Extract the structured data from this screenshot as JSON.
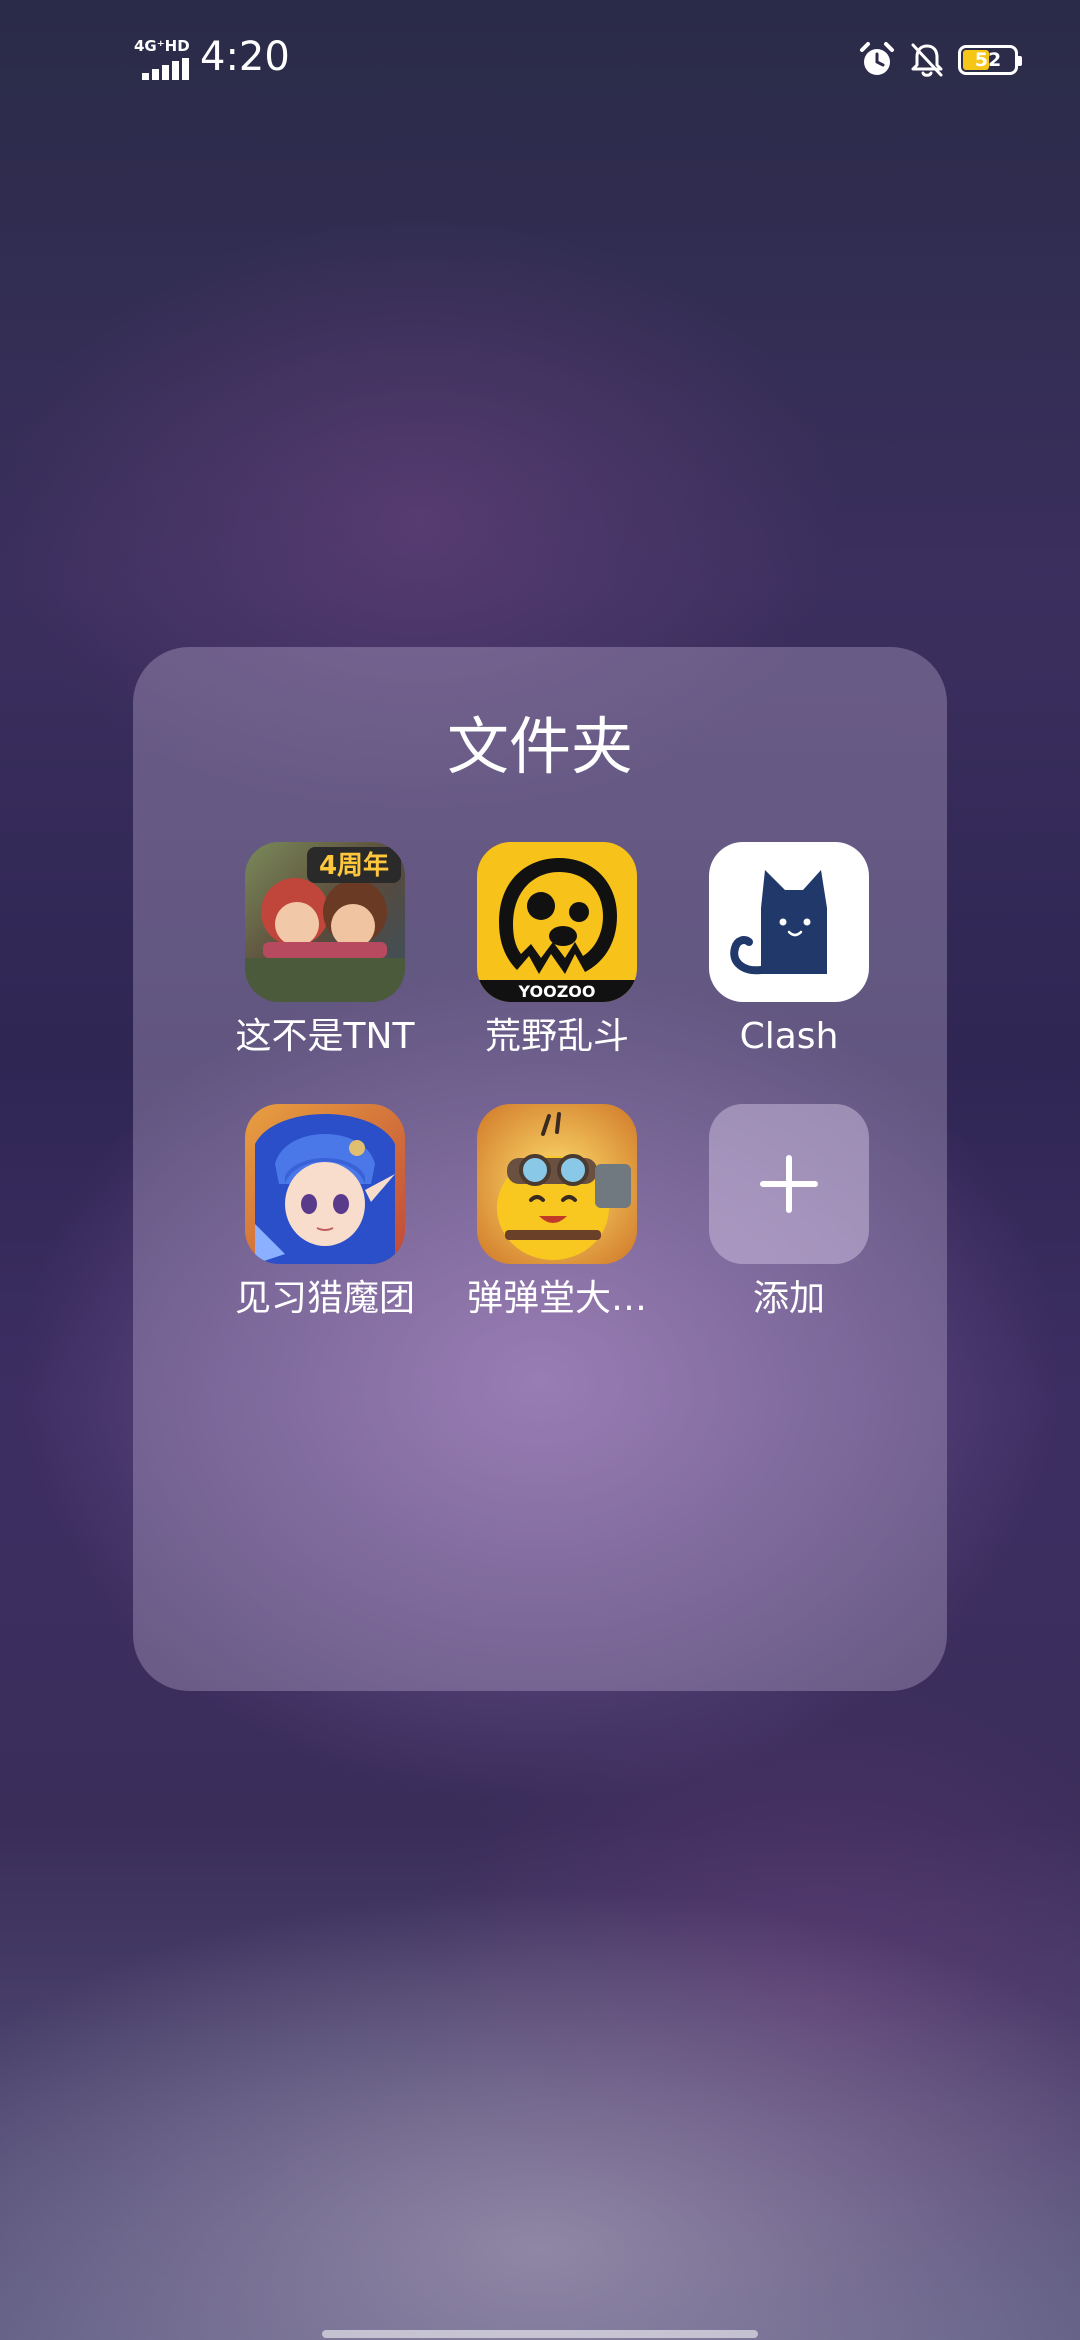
{
  "status_bar": {
    "network": "4G⁺HD",
    "time": "4:20",
    "battery_level": "52",
    "battery_fraction": 0.52,
    "icons": [
      "alarm-icon",
      "bell-off-icon",
      "battery-icon"
    ],
    "battery_color": "#f5c518"
  },
  "folder": {
    "title": "文件夹",
    "apps": [
      {
        "label": "这不是TNT",
        "icon": "tnt-game-icon"
      },
      {
        "label": "荒野乱斗",
        "icon": "brawl-stars-icon"
      },
      {
        "label": "Clash",
        "icon": "clash-cat-icon"
      },
      {
        "label": "见习猎魔团",
        "icon": "hunter-girl-icon"
      },
      {
        "label": "弹弹堂大…",
        "icon": "ddtank-chick-icon"
      },
      {
        "label": "添加",
        "icon": "plus-icon"
      }
    ]
  },
  "icon_text": {
    "tnt_badge": "4周年",
    "brawl_brand": "YOOZOO"
  }
}
